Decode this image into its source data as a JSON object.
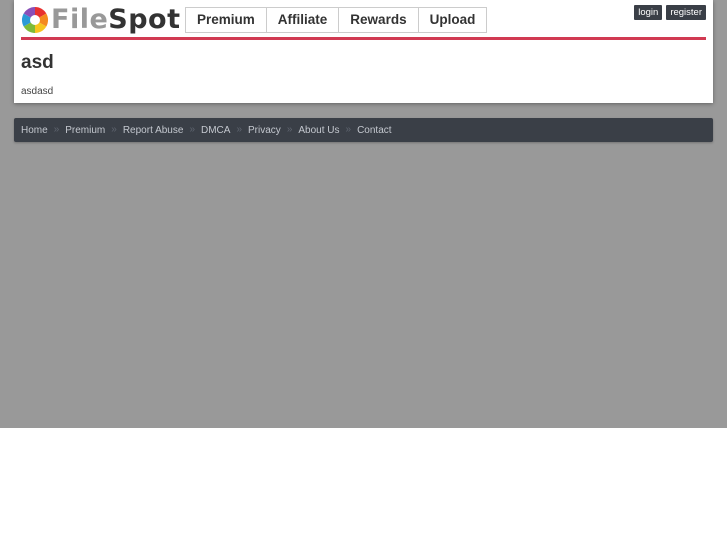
{
  "brand": {
    "name_part1": "File",
    "name_part2": "Spot"
  },
  "nav": {
    "items": [
      {
        "label": "Premium"
      },
      {
        "label": "Affiliate"
      },
      {
        "label": "Rewards"
      },
      {
        "label": "Upload"
      }
    ]
  },
  "auth": {
    "login_label": "login",
    "register_label": "register"
  },
  "page": {
    "title": "asd",
    "body": "asdasd"
  },
  "footer": {
    "separator": "»",
    "links": [
      {
        "label": "Home"
      },
      {
        "label": "Premium"
      },
      {
        "label": "Report Abuse"
      },
      {
        "label": "DMCA"
      },
      {
        "label": "Privacy"
      },
      {
        "label": "About Us"
      },
      {
        "label": "Contact"
      }
    ]
  },
  "colors": {
    "accent_red": "#d13a52",
    "dark_bar": "#3a3f47",
    "page_background": "#999999"
  }
}
